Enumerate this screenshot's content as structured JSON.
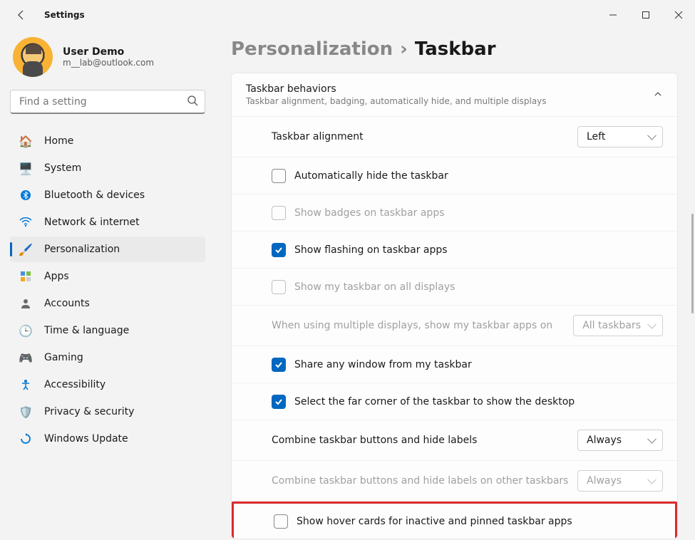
{
  "window": {
    "title": "Settings"
  },
  "user": {
    "name": "User Demo",
    "email": "m__lab@outlook.com"
  },
  "search": {
    "placeholder": "Find a setting"
  },
  "nav": {
    "home": "Home",
    "system": "System",
    "bluetooth": "Bluetooth & devices",
    "network": "Network & internet",
    "personalization": "Personalization",
    "apps": "Apps",
    "accounts": "Accounts",
    "time": "Time & language",
    "gaming": "Gaming",
    "accessibility": "Accessibility",
    "privacy": "Privacy & security",
    "update": "Windows Update"
  },
  "breadcrumb": {
    "parent": "Personalization",
    "current": "Taskbar"
  },
  "behaviors": {
    "title": "Taskbar behaviors",
    "subtitle": "Taskbar alignment, badging, automatically hide, and multiple displays",
    "alignment_label": "Taskbar alignment",
    "alignment_value": "Left",
    "auto_hide": "Automatically hide the taskbar",
    "badges": "Show badges on taskbar apps",
    "flashing": "Show flashing on taskbar apps",
    "all_displays": "Show my taskbar on all displays",
    "multi_label": "When using multiple displays, show my taskbar apps on",
    "multi_value": "All taskbars",
    "share_window": "Share any window from my taskbar",
    "far_corner": "Select the far corner of the taskbar to show the desktop",
    "combine_label": "Combine taskbar buttons and hide labels",
    "combine_value": "Always",
    "combine_other_label": "Combine taskbar buttons and hide labels on other taskbars",
    "combine_other_value": "Always",
    "hover_cards": "Show hover cards for inactive and pinned taskbar apps"
  }
}
